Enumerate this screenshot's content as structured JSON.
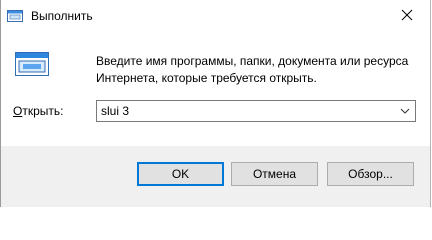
{
  "window": {
    "title": "Выполнить",
    "icon": "run-dialog-icon"
  },
  "description": {
    "line1": "Введите имя программы, папки, документа или ресурса",
    "line2": "Интернета, которые требуется открыть."
  },
  "open_field": {
    "label_accel": "О",
    "label_rest": "ткрыть:",
    "value": "slui 3"
  },
  "buttons": {
    "ok": "OK",
    "cancel": "Отмена",
    "browse": "Обзор..."
  },
  "colors": {
    "default_button_border": "#0078d7",
    "footer_background": "#f0f0f0"
  }
}
